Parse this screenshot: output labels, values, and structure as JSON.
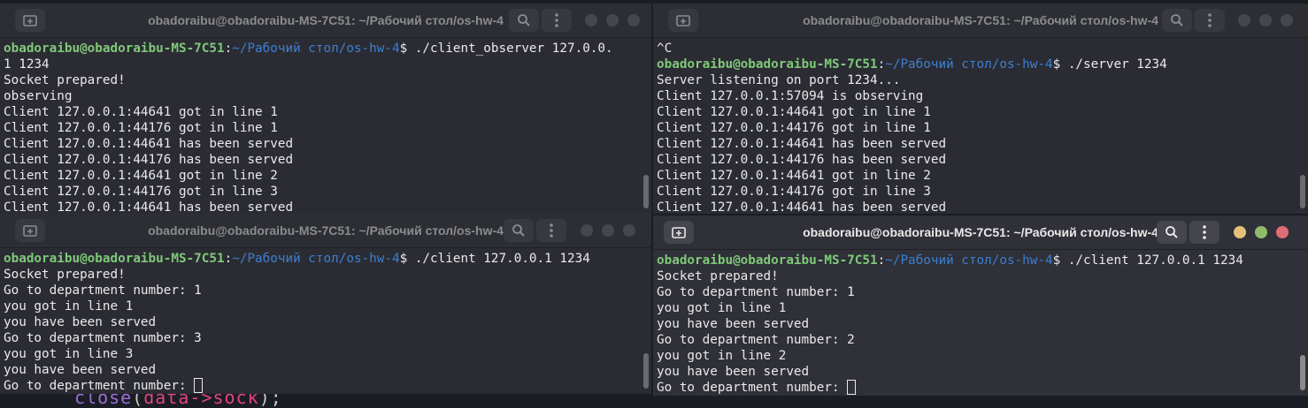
{
  "background": {
    "code_fn": "close",
    "code_open": "(",
    "code_arg": "data->sock",
    "code_close": ");"
  },
  "windows": [
    {
      "title": "obadoraibu@obadoraibu-MS-7C51: ~/Рабочий стол/os-hw-4",
      "lines": [
        {
          "prompt": true,
          "user": "obadoraibu@obadoraibu-MS-7C51",
          "colon": ":",
          "path": "~/Рабочий стол/os-hw-4",
          "cmd": "$ ./client_observer 127.0.0."
        },
        {
          "text": "1 1234"
        },
        {
          "text": "Socket prepared!"
        },
        {
          "text": "observing"
        },
        {
          "text": "Client 127.0.0.1:44641 got in line 1"
        },
        {
          "text": "Client 127.0.0.1:44176 got in line 1"
        },
        {
          "text": "Client 127.0.0.1:44641 has been served"
        },
        {
          "text": "Client 127.0.0.1:44176 has been served"
        },
        {
          "text": "Client 127.0.0.1:44641 got in line 2"
        },
        {
          "text": "Client 127.0.0.1:44176 got in line 3"
        },
        {
          "text": "Client 127.0.0.1:44641 has been served"
        }
      ]
    },
    {
      "title": "obadoraibu@obadoraibu-MS-7C51: ~/Рабочий стол/os-hw-4",
      "lines": [
        {
          "text": "^C"
        },
        {
          "prompt": true,
          "user": "obadoraibu@obadoraibu-MS-7C51",
          "colon": ":",
          "path": "~/Рабочий стол/os-hw-4",
          "cmd": "$ ./server 1234"
        },
        {
          "text": "Server listening on port 1234..."
        },
        {
          "text": "Client 127.0.0.1:57094 is observing"
        },
        {
          "text": "Client 127.0.0.1:44641 got in line 1"
        },
        {
          "text": "Client 127.0.0.1:44176 got in line 1"
        },
        {
          "text": "Client 127.0.0.1:44641 has been served"
        },
        {
          "text": "Client 127.0.0.1:44176 has been served"
        },
        {
          "text": "Client 127.0.0.1:44641 got in line 2"
        },
        {
          "text": "Client 127.0.0.1:44176 got in line 3"
        },
        {
          "text": "Client 127.0.0.1:44641 has been served"
        }
      ]
    },
    {
      "title": "obadoraibu@obadoraibu-MS-7C51: ~/Рабочий стол/os-hw-4",
      "lines": [
        {
          "prompt": true,
          "user": "obadoraibu@obadoraibu-MS-7C51",
          "colon": ":",
          "path": "~/Рабочий стол/os-hw-4",
          "cmd": "$ ./client 127.0.0.1 1234"
        },
        {
          "text": "Socket prepared!"
        },
        {
          "text": "Go to department number: 1"
        },
        {
          "text": "you got in line 1"
        },
        {
          "text": "you have been served"
        },
        {
          "text": "Go to department number: 3"
        },
        {
          "text": "you got in line 3"
        },
        {
          "text": "you have been served"
        },
        {
          "text": "Go to department number: ",
          "cursor": true
        }
      ]
    },
    {
      "title": "obadoraibu@obadoraibu-MS-7C51: ~/Рабочий стол/os-hw-4",
      "focused": true,
      "lines": [
        {
          "prompt": true,
          "user": "obadoraibu@obadoraibu-MS-7C51",
          "colon": ":",
          "path": "~/Рабочий стол/os-hw-4",
          "cmd": "$ ./client 127.0.0.1 1234"
        },
        {
          "text": "Socket prepared!"
        },
        {
          "text": "Go to department number: 1"
        },
        {
          "text": "you got in line 1"
        },
        {
          "text": "you have been served"
        },
        {
          "text": "Go to department number: 2"
        },
        {
          "text": "you got in line 2"
        },
        {
          "text": "you have been served"
        },
        {
          "text": "Go to department number: ",
          "cursor": true
        }
      ]
    }
  ]
}
